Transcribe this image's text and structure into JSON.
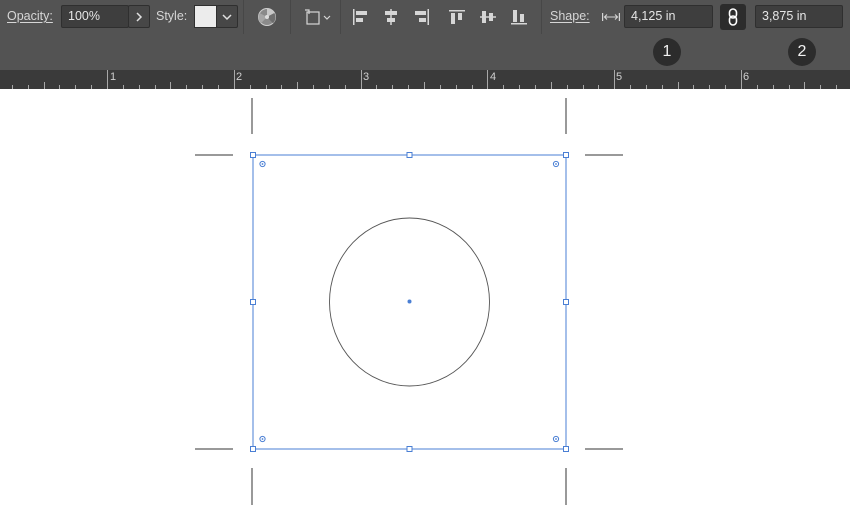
{
  "control_bar": {
    "opacity_label": "Opacity:",
    "opacity_value": "100%",
    "style_label": "Style:",
    "shape_label": "Shape:",
    "width_value": "4,125 in",
    "height_value": "3,875 in"
  },
  "annotations": {
    "badge_1": "1",
    "badge_2": "2"
  },
  "ruler": {
    "numbers": [
      "1",
      "2",
      "3",
      "4",
      "5",
      "6"
    ]
  },
  "colors": {
    "panel": "#535353",
    "ruler": "#3a3a3a",
    "selection": "#4a7fd4"
  }
}
